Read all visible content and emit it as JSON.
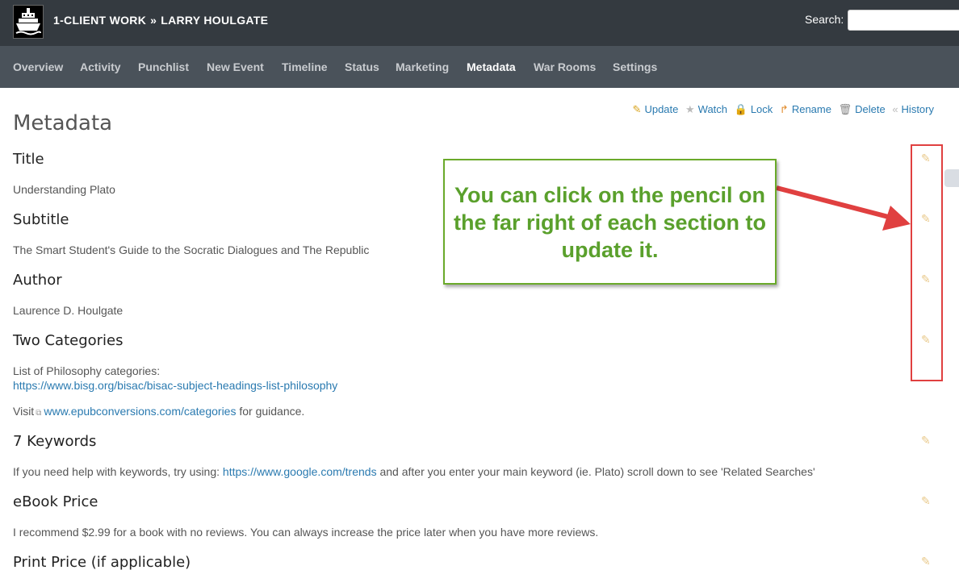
{
  "header": {
    "project": "1-CLIENT WORK",
    "separator": "»",
    "client": "LARRY HOULGATE",
    "search_label": "Search:",
    "search_value": ""
  },
  "nav": {
    "tabs": [
      "Overview",
      "Activity",
      "Punchlist",
      "New Event",
      "Timeline",
      "Status",
      "Marketing",
      "Metadata",
      "War Rooms",
      "Settings"
    ],
    "active": "Metadata"
  },
  "page": {
    "title": "Metadata",
    "actions": [
      {
        "label": "Update",
        "icon": "pencil-icon"
      },
      {
        "label": "Watch",
        "icon": "star-icon"
      },
      {
        "label": "Lock",
        "icon": "lock-icon"
      },
      {
        "label": "Rename",
        "icon": "rename-arrow-icon"
      },
      {
        "label": "Delete",
        "icon": "trash-icon"
      },
      {
        "label": "History",
        "icon": "history-icon"
      }
    ]
  },
  "sections": {
    "title": {
      "heading": "Title",
      "value": "Understanding Plato"
    },
    "subtitle": {
      "heading": "Subtitle",
      "value": "The Smart Student's Guide to the Socratic Dialogues and The Republic"
    },
    "author": {
      "heading": "Author",
      "value": "Laurence D. Houlgate"
    },
    "categories": {
      "heading": "Two Categories",
      "line1": "List of Philosophy categories:",
      "link1": "https://www.bisg.org/bisac/bisac-subject-headings-list-philosophy",
      "visit": "Visit",
      "link2": "www.epubconversions.com/categories",
      "after": "for guidance."
    },
    "keywords": {
      "heading": "7 Keywords",
      "before": "If you need help with keywords, try using:",
      "link": "https://www.google.com/trends",
      "after": "and after you enter your main keyword (ie. Plato) scroll down to see 'Related Searches'"
    },
    "ebook_price": {
      "heading": "eBook Price",
      "value": "I recommend $2.99 for a book with no reviews. You can always increase the price later when you have more reviews."
    },
    "print_price": {
      "heading": "Print Price (if applicable)"
    }
  },
  "annotation": {
    "callout_text": "You can click on the pencil on the far right of each section to update it.",
    "box_color": "#e04040",
    "callout_color": "#5aa02c"
  }
}
